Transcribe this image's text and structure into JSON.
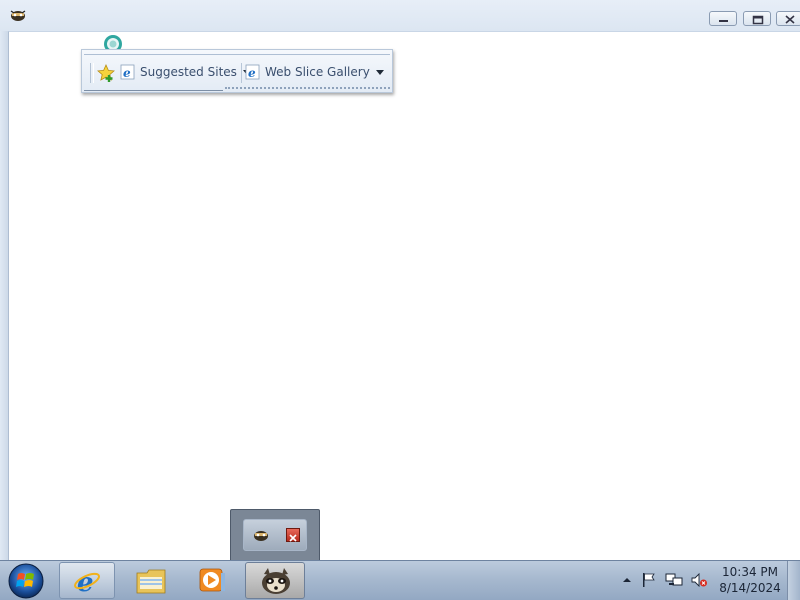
{
  "window": {
    "title_icon": "app-icon",
    "controls": [
      "minimize",
      "maximize",
      "close"
    ]
  },
  "favorites_bar": {
    "items": [
      {
        "label": "Suggested Sites",
        "icon": "ie-icon"
      },
      {
        "label": "Web Slice Gallery",
        "icon": "ie-icon"
      }
    ]
  },
  "thumbnail": {
    "close_icon": "close-icon"
  },
  "taskbar": {
    "pinned": [
      "internet-explorer",
      "windows-explorer",
      "media-player",
      "active-app"
    ],
    "clock": {
      "time": "10:34 PM",
      "date": "8/14/2024"
    }
  },
  "colors": {
    "taskbar": "#a7b9cf",
    "accent": "#1f6fc5"
  }
}
